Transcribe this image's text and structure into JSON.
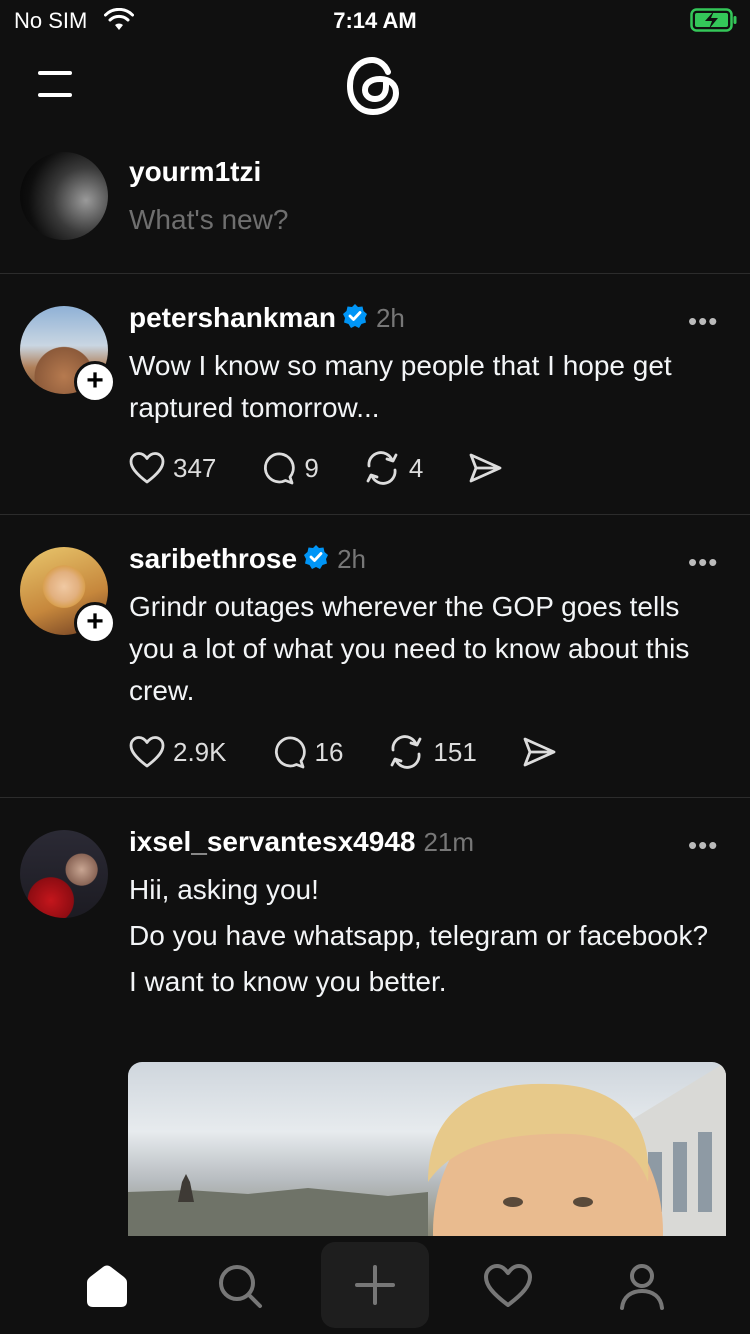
{
  "status_bar": {
    "carrier": "No SIM",
    "time": "7:14 AM"
  },
  "composer": {
    "username": "yourm1tzi",
    "placeholder": "What's new?"
  },
  "posts": [
    {
      "username": "petershankman",
      "verified": true,
      "time": "2h",
      "text": [
        "Wow I know so many people that I hope get raptured tomorrow..."
      ],
      "likes": "347",
      "replies": "9",
      "reposts": "4"
    },
    {
      "username": "saribethrose",
      "verified": true,
      "time": "2h",
      "text": [
        "Grindr outages wherever the GOP goes tells you a lot of what you need to know about this crew."
      ],
      "likes": "2.9K",
      "replies": "16",
      "reposts": "151"
    },
    {
      "username": "ixsel_servantesx4948",
      "verified": false,
      "time": "21m",
      "text": [
        "Hii, asking you!",
        "Do you have whatsapp, telegram or facebook?",
        "I want to know you better."
      ]
    }
  ],
  "colors": {
    "background": "#101010",
    "verified": "#0095f6",
    "muted": "#777777"
  },
  "tabs": [
    "home-icon",
    "search-icon",
    "new-thread-icon",
    "activity-icon",
    "profile-icon"
  ]
}
